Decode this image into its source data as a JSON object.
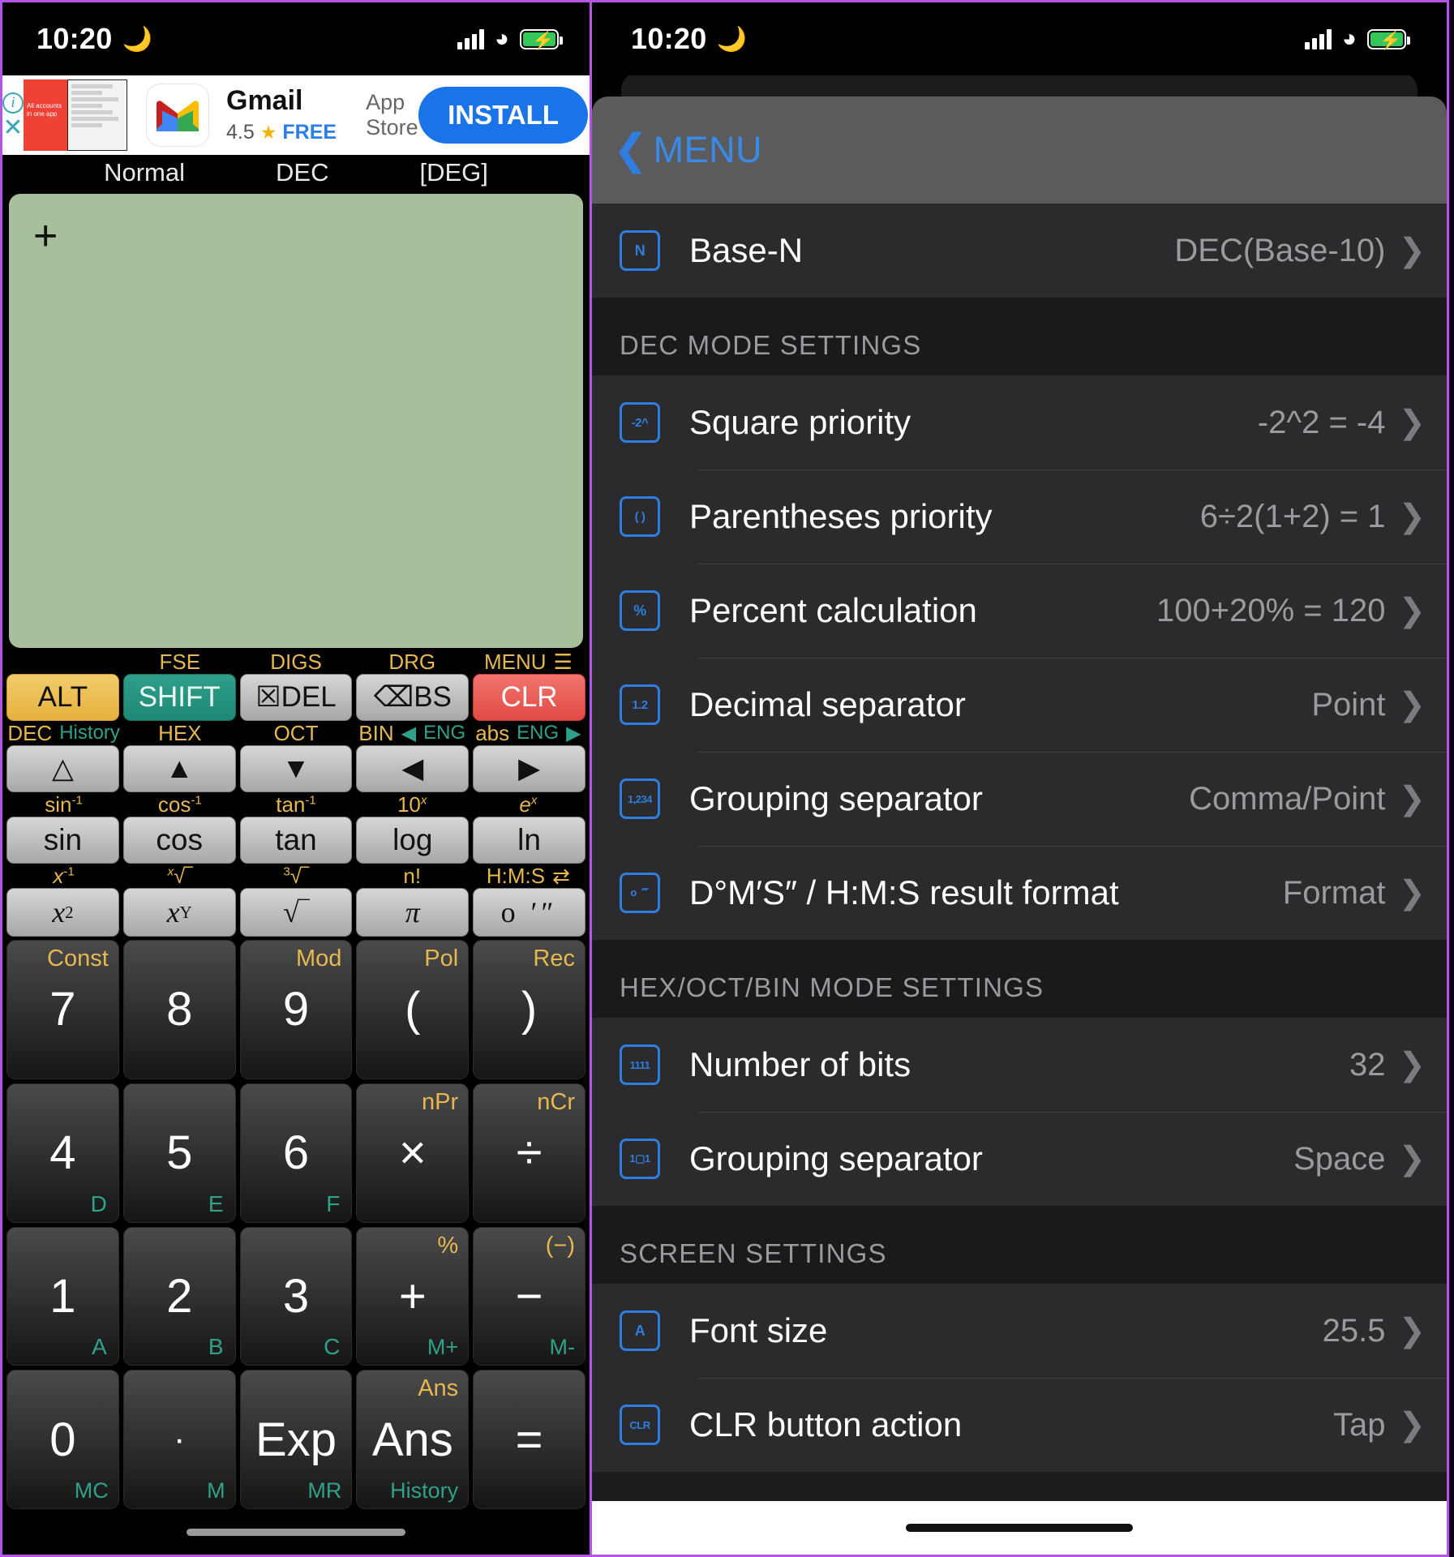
{
  "left_phone": {
    "status": {
      "time": "10:20",
      "moon_icon": "crescent-moon",
      "signal_icon": "cellular-bars",
      "wifi_icon": "wifi",
      "battery_icon": "battery-charging"
    },
    "ad": {
      "info_icon": "info-circle-icon",
      "close_icon": "close-x-icon",
      "thumb_caption": "All accounts in one app",
      "app_icon": "gmail-icon",
      "title": "Gmail",
      "rating": "4.5",
      "star_icon": "star-icon",
      "price": "FREE",
      "store": "App Store",
      "install_label": "INSTALL"
    },
    "calculator": {
      "mode_bar": [
        "Normal",
        "DEC",
        "[DEG]"
      ],
      "display_cursor": "+",
      "row_alt_top_labels": [
        "",
        "FSE",
        "DIGS",
        "DRG",
        "MENU"
      ],
      "menu_icon": "hamburger-menu-icon",
      "row_alt_keys": [
        "ALT",
        "SHIFT",
        "DEL",
        "BS",
        "CLR"
      ],
      "del_icon": "delete-left-icon",
      "bs_icon": "backspace-icon",
      "row_arrow_top_labels": [
        "DEC",
        "HEX",
        "OCT",
        "BIN",
        "abs"
      ],
      "row_arrow_top_sub": [
        "History",
        "",
        "",
        "ENG",
        "ENG"
      ],
      "row_arrow_keys": [
        "triangle-up-outline",
        "triangle-up-filled",
        "triangle-down-filled",
        "triangle-left-filled",
        "triangle-right-filled"
      ],
      "row_trig_top_labels": [
        "sin-1",
        "cos-1",
        "tan-1",
        "10x",
        "ex"
      ],
      "row_trig_keys": [
        "sin",
        "cos",
        "tan",
        "log",
        "ln"
      ],
      "row_pow_top_labels": [
        "x-1",
        "x√",
        "3√",
        "n!",
        "H:M:S"
      ],
      "row_pow_keys": [
        "x2",
        "xY",
        "√",
        "π",
        "o ′ ″"
      ],
      "numpad": [
        [
          {
            "main": "7",
            "tr": "Const",
            "br": ""
          },
          {
            "main": "8",
            "tr": "",
            "br": ""
          },
          {
            "main": "9",
            "tr": "Mod",
            "br": ""
          },
          {
            "main": "(",
            "tr": "Pol",
            "br": ""
          },
          {
            "main": ")",
            "tr": "Rec",
            "br": ""
          }
        ],
        [
          {
            "main": "4",
            "tr": "",
            "br": "D"
          },
          {
            "main": "5",
            "tr": "",
            "br": "E"
          },
          {
            "main": "6",
            "tr": "",
            "br": "F"
          },
          {
            "main": "×",
            "tr": "nPr",
            "br": ""
          },
          {
            "main": "÷",
            "tr": "nCr",
            "br": ""
          }
        ],
        [
          {
            "main": "1",
            "tr": "",
            "br": "A"
          },
          {
            "main": "2",
            "tr": "",
            "br": "B"
          },
          {
            "main": "3",
            "tr": "",
            "br": "C"
          },
          {
            "main": "+",
            "tr": "%",
            "br": "M+"
          },
          {
            "main": "−",
            "tr": "(−)",
            "br": "M-"
          }
        ],
        [
          {
            "main": "0",
            "tr": "",
            "br": "MC"
          },
          {
            "main": "·",
            "tr": "",
            "br": "M"
          },
          {
            "main": "Exp",
            "tr": "",
            "br": "MR"
          },
          {
            "main": "Ans",
            "tr": "Ans",
            "br": "History"
          },
          {
            "main": "=",
            "tr": "",
            "br": ""
          }
        ]
      ]
    }
  },
  "right_phone": {
    "status": {
      "time": "10:20",
      "moon_icon": "crescent-moon",
      "signal_icon": "cellular-bars",
      "wifi_icon": "wifi",
      "battery_icon": "battery-charging"
    },
    "header": {
      "back_icon": "chevron-left-icon",
      "title": "MENU"
    },
    "top_group": [
      {
        "icon": "base-n-icon",
        "icon_glyph": "N",
        "label": "Base-N",
        "value": "DEC(Base-10)",
        "chevron": "chevron-right-icon"
      }
    ],
    "sections": [
      {
        "heading": "DEC MODE SETTINGS",
        "rows": [
          {
            "icon": "square-priority-icon",
            "icon_glyph": "-2^",
            "label": "Square priority",
            "value": "-2^2 = -4",
            "chevron": "chevron-right-icon"
          },
          {
            "icon": "parentheses-priority-icon",
            "icon_glyph": "( )",
            "label": "Parentheses priority",
            "value": "6÷2(1+2) = 1",
            "chevron": "chevron-right-icon"
          },
          {
            "icon": "percent-icon",
            "icon_glyph": "%",
            "label": "Percent calculation",
            "value": "100+20% = 120",
            "chevron": "chevron-right-icon"
          },
          {
            "icon": "decimal-separator-icon",
            "icon_glyph": "1.2",
            "label": "Decimal separator",
            "value": "Point",
            "chevron": "chevron-right-icon"
          },
          {
            "icon": "grouping-separator-icon",
            "icon_glyph": "1,234",
            "label": "Grouping separator",
            "value": "Comma/Point",
            "chevron": "chevron-right-icon"
          },
          {
            "icon": "dms-format-icon",
            "icon_glyph": "o ⁗",
            "label": "D°M′S″ / H:M:S result format",
            "value": "Format",
            "chevron": "chevron-right-icon"
          }
        ]
      },
      {
        "heading": "HEX/OCT/BIN MODE SETTINGS",
        "rows": [
          {
            "icon": "number-of-bits-icon",
            "icon_glyph": "1111",
            "label": "Number of bits",
            "value": "32",
            "chevron": "chevron-right-icon"
          },
          {
            "icon": "grouping-separator-bin-icon",
            "icon_glyph": "1▢1",
            "label": "Grouping separator",
            "value": "Space",
            "chevron": "chevron-right-icon"
          }
        ]
      },
      {
        "heading": "SCREEN SETTINGS",
        "rows": [
          {
            "icon": "font-size-icon",
            "icon_glyph": "A",
            "label": "Font size",
            "value": "25.5",
            "chevron": "chevron-right-icon"
          },
          {
            "icon": "clr-button-icon",
            "icon_glyph": "CLR",
            "label": "CLR button action",
            "value": "Tap",
            "chevron": "chevron-right-icon"
          }
        ]
      }
    ]
  },
  "colors": {
    "accent_blue": "#2f7ee0",
    "display_green": "#a8bf9b",
    "alt_yellow": "#e5b13e",
    "shift_teal": "#1d8874",
    "clr_red": "#e14a44",
    "label_gold": "#e6b84f",
    "label_teal": "#2fa18a"
  }
}
